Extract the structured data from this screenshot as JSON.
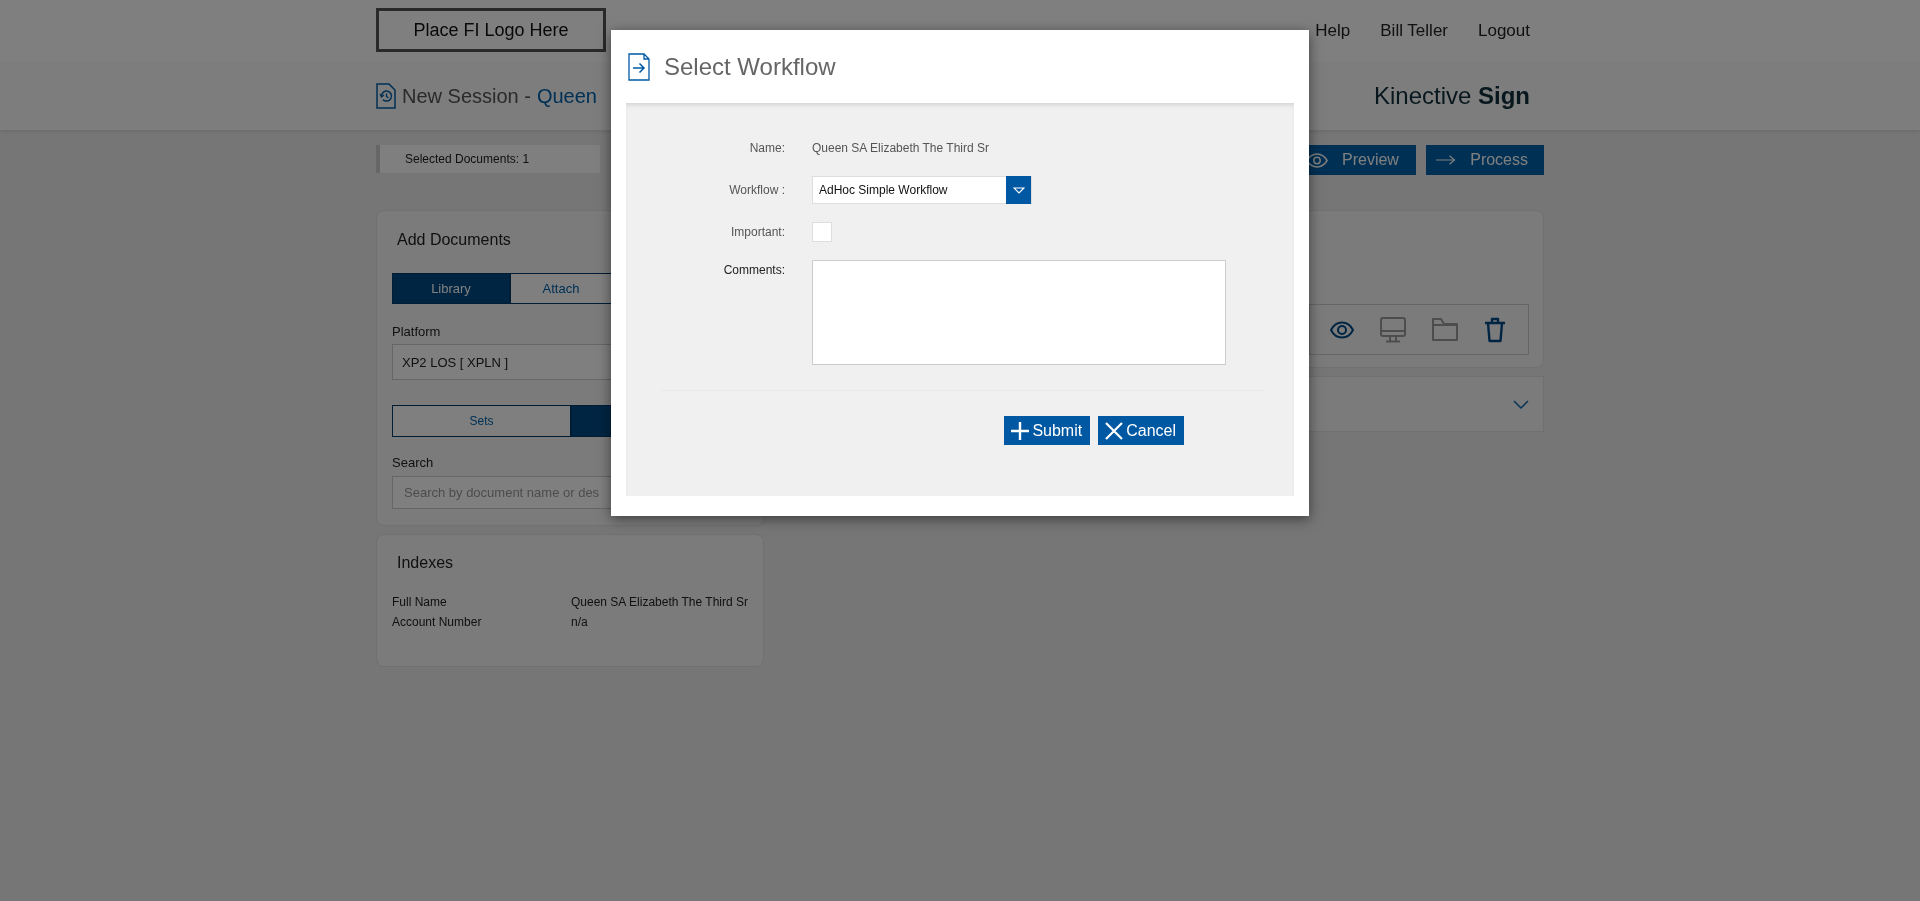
{
  "header": {
    "logo_text": "Place FI Logo Here",
    "nav": [
      "Help",
      "Bill Teller",
      "Logout"
    ]
  },
  "subheader": {
    "title": "New Session -",
    "customer": "Queen",
    "brand": "Kinective **Sign**"
  },
  "toolbar": {
    "selected_documents": "Selected Documents: 1",
    "buttons": [
      {
        "kind": "preview",
        "label": "Preview"
      },
      {
        "kind": "process",
        "label": "Process"
      }
    ]
  },
  "add_documents": {
    "title": "Add Documents",
    "tabs": [
      {
        "label": "Library",
        "selected": true
      },
      {
        "label": "Attach",
        "selected": false
      }
    ],
    "platform": {
      "label": "Platform",
      "value": "XP2 LOS [ XPLN ]"
    },
    "view_toggle": [
      {
        "label": "Sets",
        "selected": false
      },
      {
        "selected": true
      }
    ],
    "search": {
      "label": "Search",
      "placeholder": "Search by document name or des"
    }
  },
  "indexes": {
    "title": "Indexes",
    "rows": [
      {
        "label": "Full Name",
        "value": "Queen SA Elizabeth The Third Sr"
      },
      {
        "label": "Account Number",
        "value": "n/a"
      }
    ]
  },
  "document_actions": [
    {
      "kind": "eye",
      "disabled": false
    },
    {
      "kind": "monitor",
      "disabled": true
    },
    {
      "kind": "folder",
      "disabled": true
    },
    {
      "kind": "trash",
      "disabled": false
    }
  ],
  "collapsed_panel": {
    "expanded": false
  },
  "dialog": {
    "title": "Select Workflow",
    "fields": [
      {
        "kind": "text",
        "label": "Name:",
        "value": "Queen SA Elizabeth The Third Sr"
      },
      {
        "kind": "select",
        "label": "Workflow :",
        "value": "AdHoc Simple Workflow"
      },
      {
        "kind": "checkbox",
        "label": "Important:",
        "checked": false
      },
      {
        "kind": "textarea",
        "label": "Comments:"
      }
    ],
    "buttons": [
      {
        "kind": "submit",
        "label": "Submit"
      },
      {
        "kind": "cancel",
        "label": "Cancel"
      }
    ]
  }
}
